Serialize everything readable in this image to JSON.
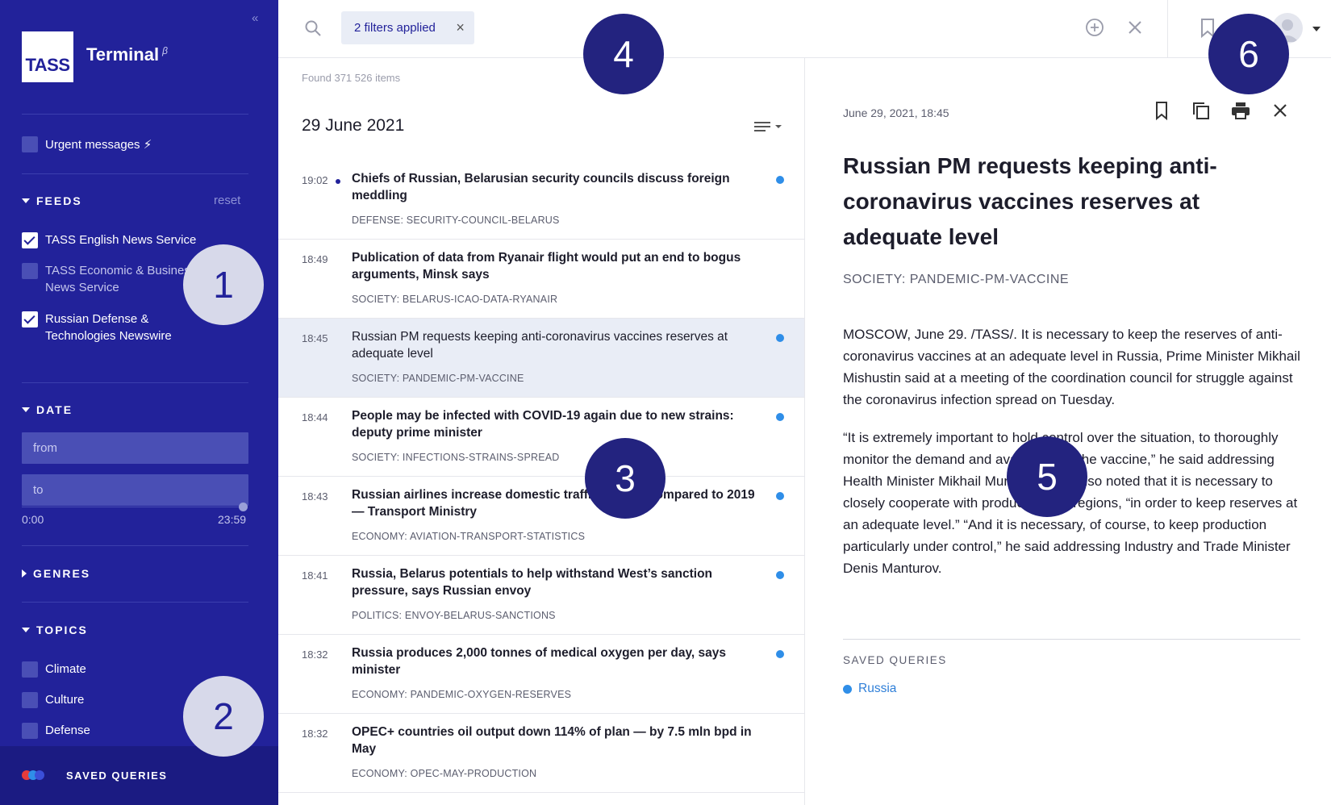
{
  "app": {
    "logo_text": "TASS",
    "title": "Terminal",
    "beta": "β",
    "collapse_glyph": "«"
  },
  "sidebar": {
    "urgent": {
      "label": "Urgent messages ⚡",
      "checked": false
    },
    "feeds": {
      "heading": "FEEDS",
      "reset": "reset",
      "items": [
        {
          "label": "TASS English News Service",
          "checked": true
        },
        {
          "label": "TASS Economic & Business News Service",
          "checked": false
        },
        {
          "label": "Russian Defense & Technologies Newswire",
          "checked": true
        }
      ]
    },
    "date": {
      "heading": "DATE",
      "from_placeholder": "from",
      "to_placeholder": "to",
      "range_start": "0:00",
      "range_end": "23:59"
    },
    "genres": {
      "heading": "GENRES"
    },
    "topics": {
      "heading": "TOPICS",
      "items": [
        {
          "label": "Climate"
        },
        {
          "label": "Culture"
        },
        {
          "label": "Defense"
        }
      ]
    },
    "footer": {
      "label": "SAVED QUERIES",
      "dot_colors": [
        "#e63b3b",
        "#2f8ee8",
        "#3b4fd8"
      ]
    }
  },
  "topbar": {
    "filter_chip": "2 filters applied",
    "chip_close": "×"
  },
  "feed": {
    "found": "Found 371 526 items",
    "date_heading": "29 June 2021",
    "items": [
      {
        "time": "19:02",
        "urgent": true,
        "title": "Chiefs of Russian, Belarusian security councils discuss foreign meddling",
        "tag": "DEFENSE: SECURITY-COUNCIL-BELARUS",
        "unread": true,
        "selected": false
      },
      {
        "time": "18:49",
        "urgent": false,
        "title": "Publication of data from Ryanair flight would put an end to bogus arguments, Minsk says",
        "tag": "SOCIETY: BELARUS-ICAO-DATA-RYANAIR",
        "unread": false,
        "selected": false
      },
      {
        "time": "18:45",
        "urgent": false,
        "title": "Russian PM requests keeping anti-coronavirus vaccines reserves at adequate level",
        "tag": "SOCIETY: PANDEMIC-PM-VACCINE",
        "unread": true,
        "selected": true
      },
      {
        "time": "18:44",
        "urgent": false,
        "title": "People may be infected with COVID-19 again due to new strains: deputy prime minister",
        "tag": "SOCIETY: INFECTIONS-STRAINS-SPREAD",
        "unread": true,
        "selected": false
      },
      {
        "time": "18:43",
        "urgent": false,
        "title": "Russian airlines increase domestic traffic by 10% compared to 2019 — Transport Ministry",
        "tag": "ECONOMY: AVIATION-TRANSPORT-STATISTICS",
        "unread": true,
        "selected": false
      },
      {
        "time": "18:41",
        "urgent": false,
        "title": "Russia, Belarus potentials to help withstand West’s sanction pressure, says Russian envoy",
        "tag": "POLITICS: ENVOY-BELARUS-SANCTIONS",
        "unread": true,
        "selected": false
      },
      {
        "time": "18:32",
        "urgent": false,
        "title": "Russia produces 2,000 tonnes of medical oxygen per day, says minister",
        "tag": "ECONOMY: PANDEMIC-OXYGEN-RESERVES",
        "unread": true,
        "selected": false
      },
      {
        "time": "18:32",
        "urgent": false,
        "title": "OPEC+ countries oil output down 114% of plan — by 7.5 mln bpd in May",
        "tag": "ECONOMY: OPEC-MAY-PRODUCTION",
        "unread": false,
        "selected": false
      }
    ]
  },
  "article": {
    "date": "June 29, 2021, 18:45",
    "title": "Russian PM requests keeping anti-coronavirus vaccines reserves at adequate level",
    "tag": "SOCIETY: PANDEMIC-PM-VACCINE",
    "paragraphs": [
      "MOSCOW, June 29. /TASS/. It is necessary to keep the reserves of anti-coronavirus vaccines at an adequate level in Russia, Prime Minister Mikhail Mishustin said at a meeting of the coordination council for struggle against the coronavirus infection spread on Tuesday.",
      "“It is extremely important to hold control over the situation, to thoroughly monitor the demand and availability of the vaccine,” he said addressing Health Minister Mikhail Murashko. PM also noted that it is necessary to closely cooperate with producers and regions, “in order to keep reserves at an adequate level.” “And it is necessary, of course, to keep production particularly under control,” he said addressing Industry and Trade Minister Denis Manturov."
    ],
    "saved_queries_title": "SAVED QUERIES",
    "saved_query": "Russia"
  },
  "markers": [
    "1",
    "2",
    "3",
    "4",
    "5",
    "6"
  ]
}
